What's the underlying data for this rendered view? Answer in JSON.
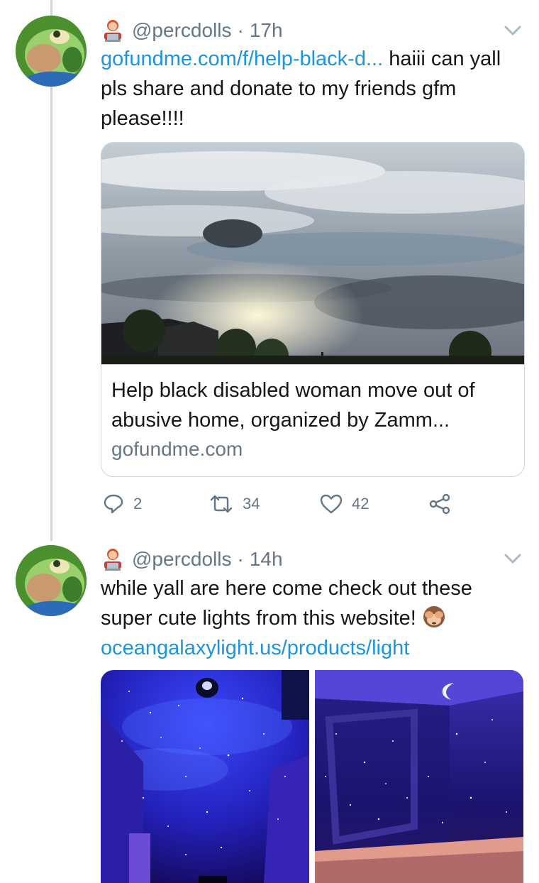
{
  "tweets": [
    {
      "handle": "@percdolls",
      "separator": "·",
      "time": "17h",
      "link_text": "gofundme.com/f/help-black-d...",
      "text": " haiii can yall pls share and donate to my friends gfm please!!!!",
      "card": {
        "title": "Help black disabled woman move out of abusive home, organized by Zamm...",
        "domain": "gofundme.com"
      },
      "actions": {
        "replies": "2",
        "retweets": "34",
        "likes": "42"
      }
    },
    {
      "handle": "@percdolls",
      "separator": "·",
      "time": "14h",
      "text": "while yall are here come check out these super cute lights from this website!",
      "link_text": "oceangalaxylight.us/products/light"
    }
  ],
  "icons": {
    "author_emoji": "woman-technologist-emoji",
    "inline_emoji": "see-no-evil-monkey-emoji",
    "reply": "reply-icon",
    "retweet": "retweet-icon",
    "like": "heart-icon",
    "share": "share-icon",
    "menu": "chevron-down-icon"
  },
  "colors": {
    "link": "#1b95e0",
    "muted": "#657786",
    "text": "#14171a",
    "border": "#ccd6dd"
  }
}
